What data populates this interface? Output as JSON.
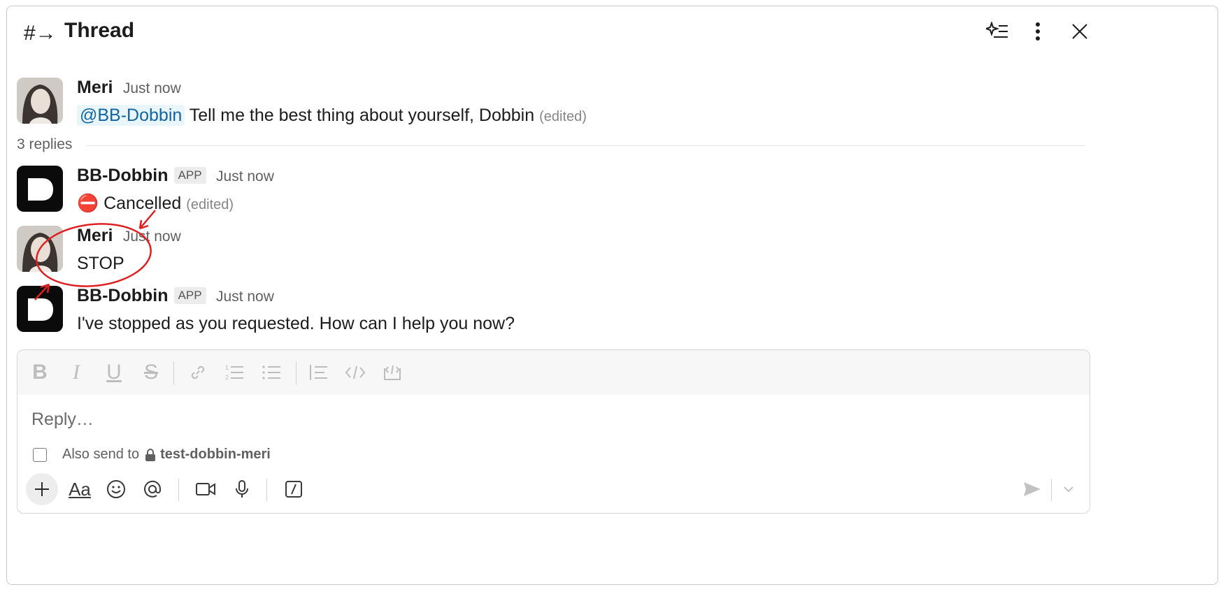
{
  "header": {
    "channel_icon": "#→",
    "title": "Thread",
    "icons": [
      "ai-summary-icon",
      "more-vertical-icon",
      "close-icon"
    ]
  },
  "root_message": {
    "author": "Meri",
    "timestamp": "Just now",
    "mention": "@BB-Dobbin",
    "text": "Tell me the best thing about yourself, Dobbin",
    "edited": "(edited)"
  },
  "replies_label": "3 replies",
  "replies": [
    {
      "author": "BB-Dobbin",
      "badge": "APP",
      "timestamp": "Just now",
      "emoji": "⛔",
      "text": "Cancelled",
      "edited": "(edited)"
    },
    {
      "author": "Meri",
      "timestamp": "Just now",
      "text": "STOP"
    },
    {
      "author": "BB-Dobbin",
      "badge": "APP",
      "timestamp": "Just now",
      "text": "I've stopped as you requested. How can I help you now?"
    }
  ],
  "annotation_color": "#e02020",
  "composer": {
    "placeholder": "Reply…",
    "also_send_label": "Also send to",
    "channel": "test-dobbin-meri",
    "format_icons": [
      "bold-icon",
      "italic-icon",
      "underline-icon",
      "strikethrough-icon",
      "link-icon",
      "ordered-list-icon",
      "bulleted-list-icon",
      "blockquote-icon",
      "code-icon",
      "code-block-icon"
    ],
    "toolbar_icons": [
      "plus-icon",
      "text-format-icon",
      "emoji-icon",
      "mention-icon",
      "video-icon",
      "microphone-icon",
      "slash-command-icon",
      "send-icon",
      "chevron-down-icon"
    ],
    "text_format_label": "Aa"
  }
}
